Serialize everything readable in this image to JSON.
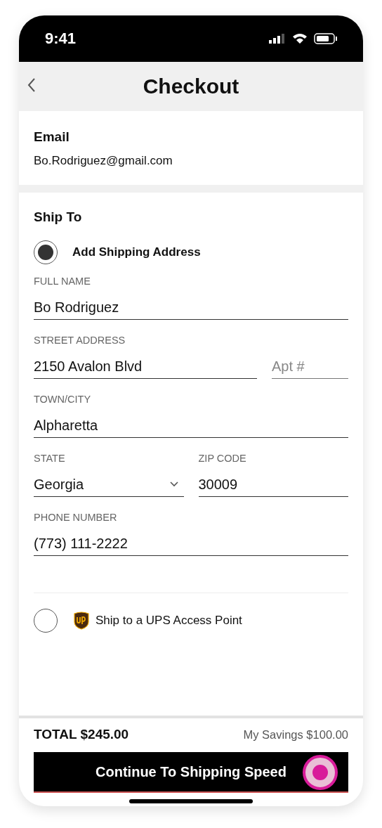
{
  "status_bar": {
    "time": "9:41"
  },
  "header": {
    "title": "Checkout"
  },
  "email": {
    "heading": "Email",
    "value": "Bo.Rodriguez@gmail.com"
  },
  "ship_to": {
    "heading": "Ship To",
    "options": [
      {
        "kind": "address",
        "label": "Add Shipping Address",
        "selected": true
      },
      {
        "kind": "access-point",
        "label": "Ship to a UPS Access Point",
        "selected": false
      }
    ],
    "form_rows": [
      [
        {
          "kind": "text",
          "label": "FULL NAME",
          "value": "Bo Rodriguez"
        }
      ],
      [
        {
          "kind": "text",
          "label": "STREET ADDRESS",
          "value": "2150 Avalon Blvd"
        },
        {
          "kind": "text",
          "placeholder": "Apt #"
        }
      ],
      [
        {
          "kind": "text",
          "label": "TOWN/CITY",
          "value": "Alpharetta"
        }
      ],
      [
        {
          "kind": "select",
          "label": "STATE",
          "value": "Georgia"
        },
        {
          "kind": "text",
          "label": "ZIP CODE",
          "value": "30009"
        }
      ],
      [
        {
          "kind": "text",
          "label": "PHONE NUMBER",
          "value": "(773) 111-2222"
        }
      ]
    ]
  },
  "footer": {
    "total": "TOTAL $245.00",
    "savings": "My Savings $100.00",
    "button": "Continue To Shipping Speed"
  }
}
